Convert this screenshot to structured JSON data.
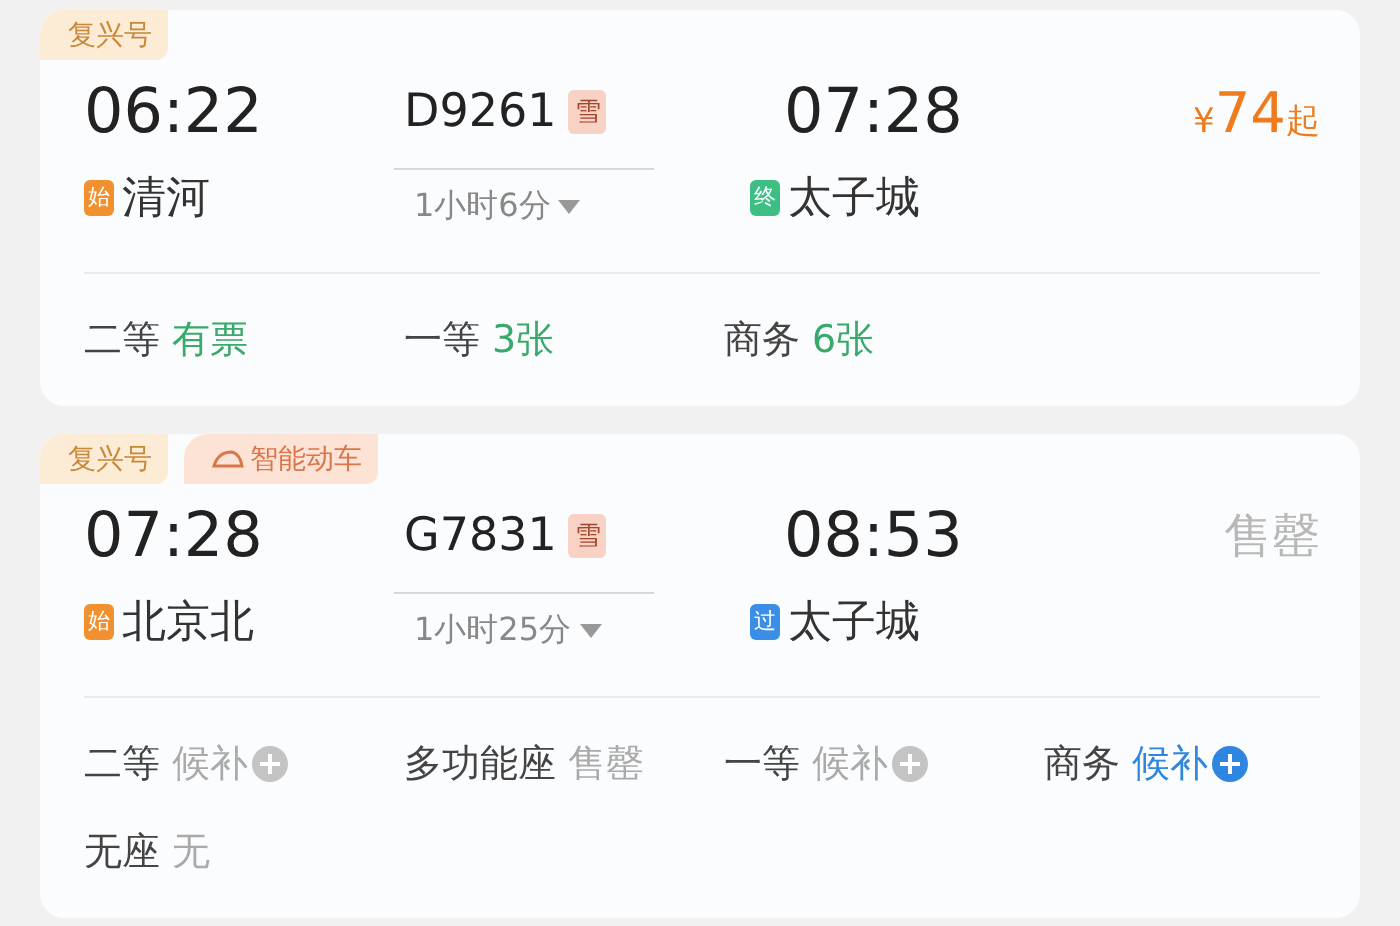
{
  "trains": [
    {
      "tags": [
        {
          "label": "复兴号",
          "kind": "fuxing"
        }
      ],
      "depart_time": "06:22",
      "train_no": "D9261",
      "snow_badge": "雪",
      "duration": "1小时6分",
      "arrive_time": "07:28",
      "from": {
        "badge": "始",
        "kind": "start",
        "name": "清河"
      },
      "to": {
        "badge": "终",
        "kind": "end",
        "name": "太子城"
      },
      "price": {
        "kind": "price",
        "currency": "¥",
        "amount": "74",
        "suffix": "起"
      },
      "seats": [
        {
          "class": "二等",
          "status": "有票",
          "kind": "available"
        },
        {
          "class": "一等",
          "status": "3张",
          "kind": "available"
        },
        {
          "class": "商务",
          "status": "6张",
          "kind": "available"
        }
      ]
    },
    {
      "tags": [
        {
          "label": "复兴号",
          "kind": "fuxing"
        },
        {
          "label": "智能动车",
          "kind": "smart"
        }
      ],
      "depart_time": "07:28",
      "train_no": "G7831",
      "snow_badge": "雪",
      "duration": "1小时25分",
      "arrive_time": "08:53",
      "from": {
        "badge": "始",
        "kind": "start",
        "name": "北京北"
      },
      "to": {
        "badge": "过",
        "kind": "pass",
        "name": "太子城"
      },
      "price": {
        "kind": "soldout",
        "text": "售罄"
      },
      "seats": [
        {
          "class": "二等",
          "status": "候补",
          "kind": "waitlist",
          "active": false
        },
        {
          "class": "多功能座",
          "status": "售罄",
          "kind": "soldout"
        },
        {
          "class": "一等",
          "status": "候补",
          "kind": "waitlist",
          "active": false
        },
        {
          "class": "商务",
          "status": "候补",
          "kind": "waitlist",
          "active": true
        },
        {
          "class": "无座",
          "status": "无",
          "kind": "none"
        }
      ]
    }
  ]
}
